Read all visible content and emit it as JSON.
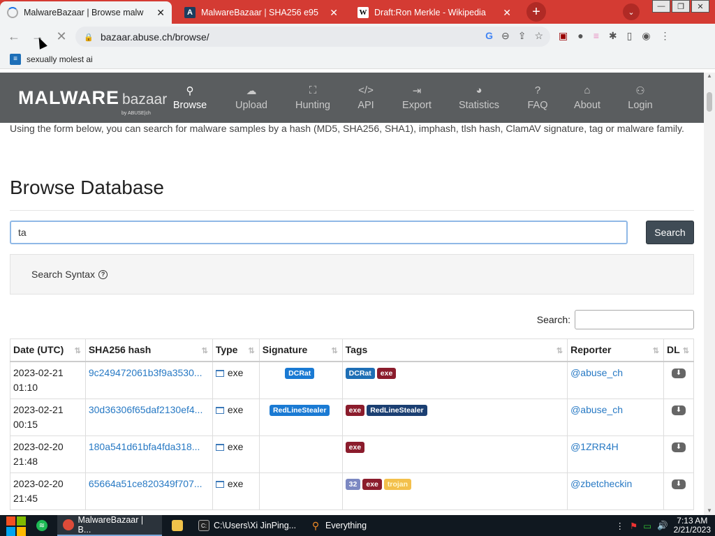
{
  "browser": {
    "tabs": [
      {
        "title": "MalwareBazaar | Browse malw",
        "active": true
      },
      {
        "title": "MalwareBazaar | SHA256 e95",
        "active": false
      },
      {
        "title": "Draft:Ron Merkle - Wikipedia",
        "active": false
      }
    ],
    "url": "bazaar.abuse.ch/browse/",
    "bookmark": "sexually molest ai"
  },
  "site": {
    "logo_main": "MALWARE",
    "logo_sub": "bazaar",
    "logo_by": "by ABUSE|ch",
    "nav": [
      {
        "label": "Browse",
        "icon": "search-icon",
        "glyph": "🔍",
        "active": true
      },
      {
        "label": "Upload",
        "icon": "cloud-upload-icon",
        "glyph": "☁",
        "active": false
      },
      {
        "label": "Hunting",
        "icon": "binoculars-icon",
        "glyph": "⛶",
        "active": false
      },
      {
        "label": "API",
        "icon": "code-icon",
        "glyph": "</>",
        "active": false
      },
      {
        "label": "Export",
        "icon": "export-icon",
        "glyph": "⇥",
        "active": false
      },
      {
        "label": "Statistics",
        "icon": "pie-chart-icon",
        "glyph": "◕",
        "active": false
      },
      {
        "label": "FAQ",
        "icon": "question-icon",
        "glyph": "?",
        "active": false
      },
      {
        "label": "About",
        "icon": "building-icon",
        "glyph": "⌂",
        "active": false
      },
      {
        "label": "Login",
        "icon": "user-icon",
        "glyph": "👤",
        "active": false
      }
    ]
  },
  "page": {
    "intro": "Using the form below, you can search for malware samples by a hash (MD5, SHA256, SHA1), imphash, tlsh hash, ClamAV signature, tag or malware family.",
    "heading": "Browse Database",
    "search_value": "ta",
    "search_button": "Search",
    "syntax_label": "Search Syntax",
    "table_search_label": "Search:"
  },
  "table": {
    "headers": [
      "Date (UTC)",
      "SHA256 hash",
      "Type",
      "Signature",
      "Tags",
      "Reporter",
      "DL"
    ],
    "rows": [
      {
        "date": "2023-02-21",
        "time": "01:10",
        "hash": "9c249472061b3f9a3530...",
        "type": "exe",
        "signature": "DCRat",
        "tags": [
          "DCRat",
          "exe"
        ],
        "reporter": "@abuse_ch"
      },
      {
        "date": "2023-02-21",
        "time": "00:15",
        "hash": "30d36306f65daf2130ef4...",
        "type": "exe",
        "signature": "RedLineStealer",
        "tags": [
          "exe",
          "RedLineStealer"
        ],
        "reporter": "@abuse_ch"
      },
      {
        "date": "2023-02-20",
        "time": "21:48",
        "hash": "180a541d61bfa4fda318...",
        "type": "exe",
        "signature": "",
        "tags": [
          "exe"
        ],
        "reporter": "@1ZRR4H"
      },
      {
        "date": "2023-02-20",
        "time": "21:45",
        "hash": "65664a51ce820349f707...",
        "type": "exe",
        "signature": "",
        "tags": [
          "32",
          "exe",
          "trojan"
        ],
        "reporter": "@zbetcheckin"
      }
    ]
  },
  "tag_colors": {
    "DCRat": "#1f6fb5",
    "exe": "#8b1c2c",
    "RedLineStealer": "#1b3f72",
    "32": "#7c88c2",
    "trojan": "#f3c04c",
    "sig_DCRat": "#1a7ad3",
    "sig_RedLineStealer": "#1a7ad3"
  },
  "taskbar": {
    "items": [
      {
        "label": "MalwareBazaar | B...",
        "open": true
      },
      {
        "label": "",
        "open": false
      },
      {
        "label": "C:\\Users\\Xi JinPing...",
        "open": false
      },
      {
        "label": "Everything",
        "open": false
      }
    ],
    "time": "7:13 AM",
    "date": "2/21/2023"
  }
}
